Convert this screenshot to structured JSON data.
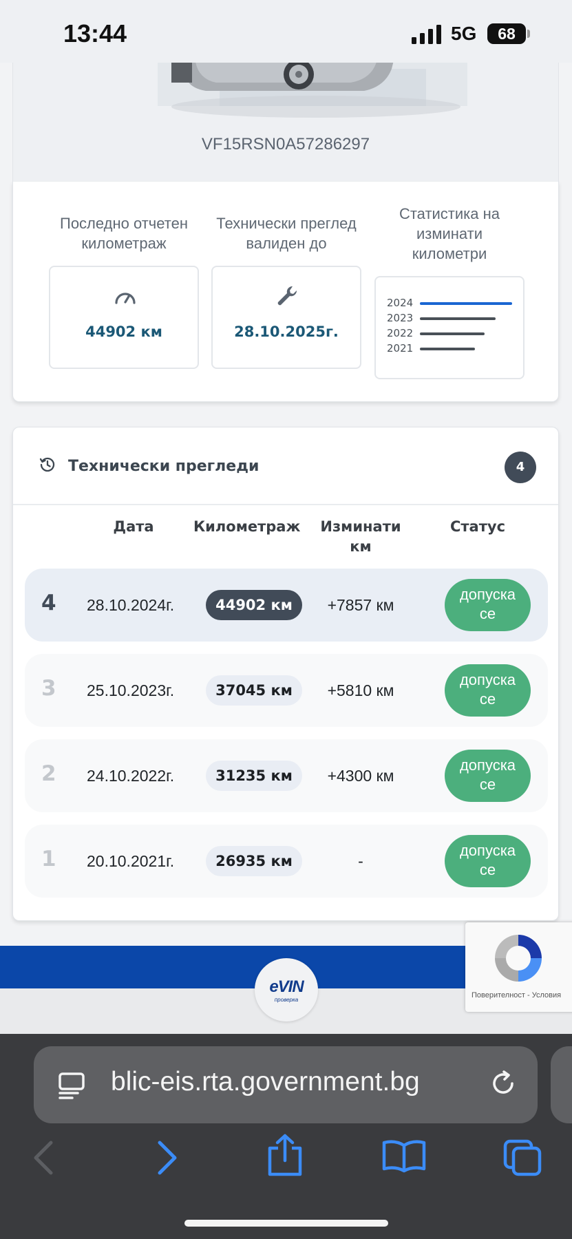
{
  "status_bar": {
    "time": "13:44",
    "network": "5G",
    "battery": "68"
  },
  "vehicle": {
    "vin": "VF15RSN0A57286297"
  },
  "stats": {
    "mileage": {
      "title_line1": "Последно отчетен",
      "title_line2": "километраж",
      "value": "44902 км",
      "icon": "speedometer-icon"
    },
    "inspection": {
      "title_line1": "Технически преглед",
      "title_line2": "валиден до",
      "value": "28.10.2025г.",
      "icon": "wrench-icon"
    },
    "km_stats": {
      "title_line1": "Статистика на",
      "title_line2": "изминати",
      "title_line3": "километри",
      "years": [
        {
          "year": "2024",
          "fraction": 1.0,
          "color": "#1a66d2"
        },
        {
          "year": "2023",
          "fraction": 0.82,
          "color": "#495057"
        },
        {
          "year": "2022",
          "fraction": 0.7,
          "color": "#495057"
        },
        {
          "year": "2021",
          "fraction": 0.6,
          "color": "#495057"
        }
      ]
    }
  },
  "inspections": {
    "title": "Технически прегледи",
    "count": "4",
    "headers": {
      "date": "Дата",
      "mileage": "Километраж",
      "driven_line1": "Изминати",
      "driven_line2": "км",
      "status": "Статус"
    },
    "rows": [
      {
        "num": "4",
        "date": "28.10.2024г.",
        "km": "44902 км",
        "delta": "+7857 км",
        "status_line1": "допуска",
        "status_line2": "се"
      },
      {
        "num": "3",
        "date": "25.10.2023г.",
        "km": "37045 км",
        "delta": "+5810 км",
        "status_line1": "допуска",
        "status_line2": "се"
      },
      {
        "num": "2",
        "date": "24.10.2022г.",
        "km": "31235 км",
        "delta": "+4300 км",
        "status_line1": "допуска",
        "status_line2": "се"
      },
      {
        "num": "1",
        "date": "20.10.2021г.",
        "km": "26935 км",
        "delta": "-",
        "status_line1": "допуска",
        "status_line2": "се"
      }
    ]
  },
  "footer": {
    "logo_text": "eVIN",
    "logo_sub": "проверка"
  },
  "recaptcha": {
    "privacy": "Поверителност",
    "separator": " - ",
    "terms": "Условия"
  },
  "browser": {
    "url": "blic-eis.rta.government.bg"
  },
  "colors": {
    "brand_blue": "#0b47a9",
    "status_green": "#4caf7d",
    "accent_dark": "#414b58",
    "value_blue": "#1b5876"
  }
}
